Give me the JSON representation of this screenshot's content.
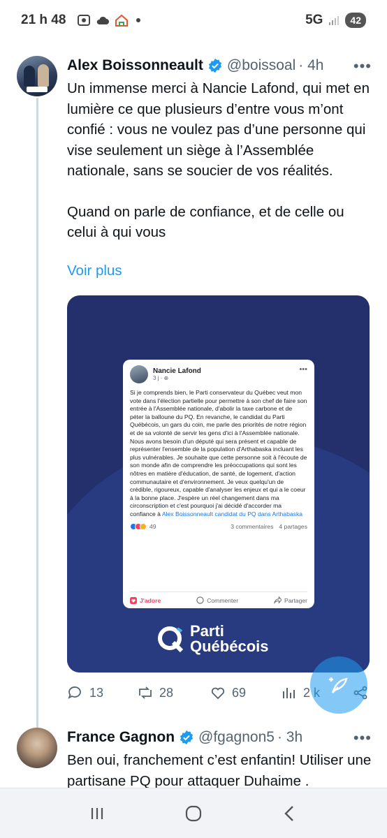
{
  "status_bar": {
    "time": "21 h 48",
    "network": "5G",
    "battery": "42"
  },
  "tweet": {
    "author": "Alex Boissonneault",
    "handle": "@boissoal",
    "time": "· 4h",
    "text_p1": "Un immense merci à Nancie Lafond,  qui met en lumière ce que plusieurs d’entre vous m’ont confié : vous ne voulez pas d’une personne qui vise seulement un siège à l’Assemblée nationale, sans se soucier de vos réalités.",
    "text_p2": "Quand on parle de confiance, et de celle ou celui à qui vous",
    "voir_plus": "Voir plus",
    "media": {
      "fb_post": {
        "name": "Nancie Lafond",
        "meta": "3 j · ⊕",
        "body": "Si je comprends bien, le Parti conservateur du Québec veut mon vote dans l'élection partielle pour permettre à son chef de faire son entrée à l'Assemblée nationale, d'abolir la taxe carbone et de péter la balloune du PQ. En revanche, le candidat du Parti Québécois, un  gars du coin, me parle des priorités de notre région et de sa volonté de servir les gens d'ici à l'Assemblée nationale. Nous avons besoin d'un député qui sera présent et capable de représenter l'ensemble de la population d'Arthabaska incluant les plus vulnérables. Je souhaite que cette personne soit à l'écoute de son monde afin de comprendre les préoccupations qui sont les nôtres en matière d'éducation, de santé, de logement, d'action communautaire et d'environnement.  Je veux quelqu'un de crédible, rigoureux, capable d'analyser les enjeux et qui a le coeur à la bonne place. J'espère un réel changement dans ma circonscription et c'est pourquoi j'ai décidé d'accorder ma confiance à",
        "link": "Alex Boissonneault candidat du PQ dans Arthabaska",
        "reactions": "49",
        "comments": "3 commentaires",
        "shares": "4 partages",
        "love": "J'adore",
        "comment": "Commenter",
        "share": "Partager"
      },
      "logo_line1": "Parti",
      "logo_line2": "Québécois"
    },
    "replies": "13",
    "reposts": "28",
    "likes": "69",
    "views": "2 k"
  },
  "tweet2": {
    "author": "France Gagnon",
    "handle": "@fgagnon5",
    "time": "· 3h",
    "text": "Ben oui, franchement c’est enfantin! Utiliser une partisane PQ pour attaquer Duhaime ."
  },
  "colors": {
    "accent": "#1d9bf0",
    "pq_blue": "#23306b"
  }
}
